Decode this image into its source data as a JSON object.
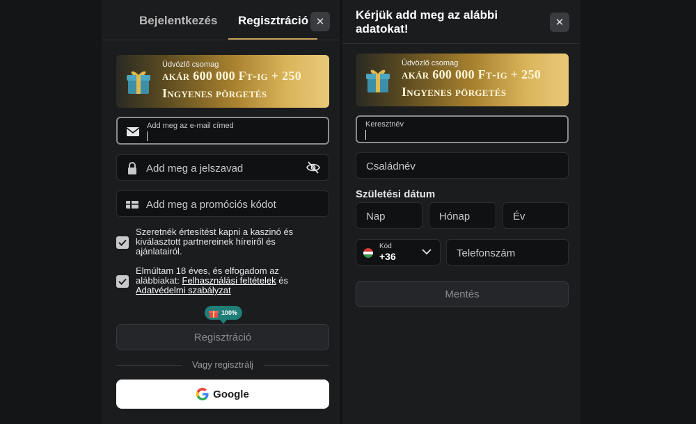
{
  "left": {
    "tabs": {
      "login": "Bejelentkezés",
      "register": "Regisztráció"
    },
    "close": "✕",
    "banner": {
      "small": "Üdvözlő csomag",
      "line1": "akár 600 000 Ft-ig + 250",
      "line2": "Ingyenes pörgetés"
    },
    "email": {
      "label": "Add meg az e-mail címed"
    },
    "password": {
      "placeholder": "Add meg a jelszavad"
    },
    "promo": {
      "placeholder": "Add meg a promóciós kódot"
    },
    "newsletter": {
      "text": "Szeretnék értesítést kapni a kaszinó és kiválasztott partnereinek híreiről és ajánlatairól."
    },
    "age": {
      "text_before": "Elmúltam 18 éves, és elfogadom az alábbiakat: ",
      "terms_link": "Felhasználási feltételek",
      "and": " és ",
      "privacy_link": "Adatvédelmi szabályzat"
    },
    "badge": {
      "percent": "100%",
      "progress": 1.0
    },
    "register_button": "Regisztráció",
    "divider": "Vagy regisztrálj",
    "google_button": "Google"
  },
  "right": {
    "title": "Kérjük add meg az alábbi adatokat!",
    "close": "✕",
    "banner": {
      "small": "Üdvözlő csomag",
      "line1": "akár 600 000 Ft-ig + 250",
      "line2": "Ingyenes pörgetés"
    },
    "firstname": {
      "label": "Keresztnév"
    },
    "lastname": {
      "placeholder": "Családnév"
    },
    "birthdate": {
      "label": "Születési dátum",
      "day": "Nap",
      "month": "Hónap",
      "year": "Év"
    },
    "country_code": {
      "label": "Kód",
      "value": "+36"
    },
    "phone": {
      "placeholder": "Telefonszám"
    },
    "save_button": "Mentés"
  },
  "colors": {
    "accent": "#c8a25a",
    "badge": "#1f7e78",
    "panel": "#1b1c1e"
  }
}
